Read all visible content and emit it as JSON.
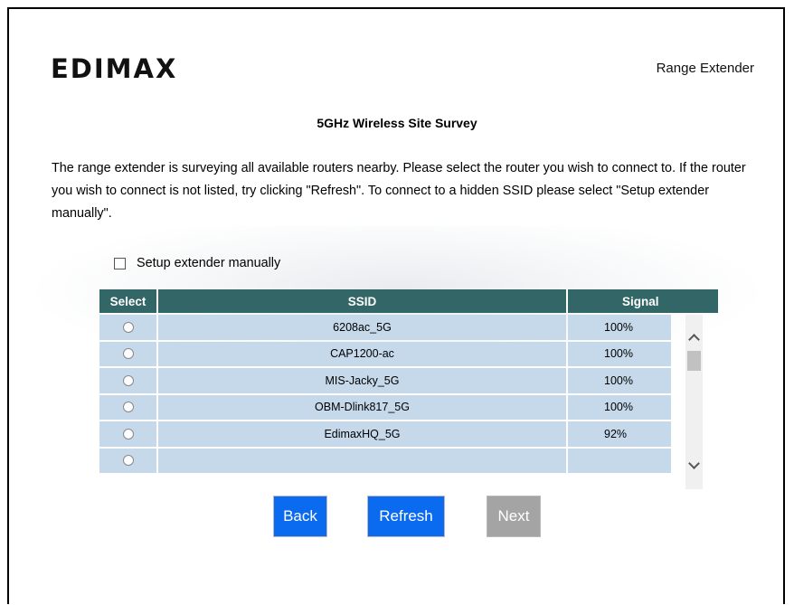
{
  "header": {
    "logo_text": "EDIMAX",
    "product": "Range Extender"
  },
  "page": {
    "title": "5GHz Wireless Site Survey",
    "description": "The range extender is surveying all available routers nearby. Please select the router you wish to connect to. If the router you wish to connect is not listed, try clicking \"Refresh\". To connect to a hidden SSID please select \"Setup extender manually\"."
  },
  "manual_setup": {
    "label": "Setup extender manually",
    "checked": false
  },
  "table": {
    "columns": [
      "Select",
      "SSID",
      "Signal"
    ],
    "rows": [
      {
        "ssid": "6208ac_5G",
        "signal": "100%"
      },
      {
        "ssid": "CAP1200-ac",
        "signal": "100%"
      },
      {
        "ssid": "MIS-Jacky_5G",
        "signal": "100%"
      },
      {
        "ssid": "OBM-Dlink817_5G",
        "signal": "100%"
      },
      {
        "ssid": "EdimaxHQ_5G",
        "signal": "92%"
      }
    ]
  },
  "buttons": {
    "back": "Back",
    "refresh": "Refresh",
    "next": "Next"
  },
  "colors": {
    "header_bg": "#336666",
    "row_bg": "#c5d9eb",
    "primary_button": "#0b6bf0",
    "disabled_button": "#a4a4a4",
    "logo_dot": "#d9001b"
  },
  "icons": {
    "scroll_up": "chevron-up-icon",
    "scroll_down": "chevron-down-icon"
  }
}
